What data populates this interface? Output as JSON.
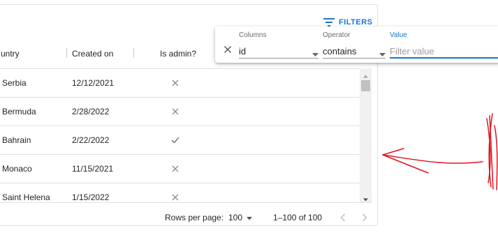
{
  "toolbar": {
    "filters_label": "FILTERS"
  },
  "columns": {
    "country": "untry",
    "created_on": "Created on",
    "is_admin": "Is admin?"
  },
  "rows": [
    {
      "country": "Serbia",
      "created_on": "12/12/2021",
      "is_admin": false
    },
    {
      "country": "Bermuda",
      "created_on": "2/28/2022",
      "is_admin": false
    },
    {
      "country": "Bahrain",
      "created_on": "2/22/2022",
      "is_admin": true
    },
    {
      "country": "Monaco",
      "created_on": "11/15/2021",
      "is_admin": false
    },
    {
      "country": "Saint Helena",
      "created_on": "1/15/2022",
      "is_admin": false
    }
  ],
  "footer": {
    "rows_per_page_label": "Rows per page:",
    "rows_per_page_value": "100",
    "range": "1–100 of 100"
  },
  "filter_panel": {
    "columns_label": "Columns",
    "columns_value": "id",
    "operator_label": "Operator",
    "operator_value": "contains",
    "value_label": "Value",
    "value_placeholder": "Filter value",
    "value_value": ""
  },
  "colors": {
    "accent": "#1976d2",
    "annotation": "#e0141e",
    "divider": "#e0e0e0"
  }
}
